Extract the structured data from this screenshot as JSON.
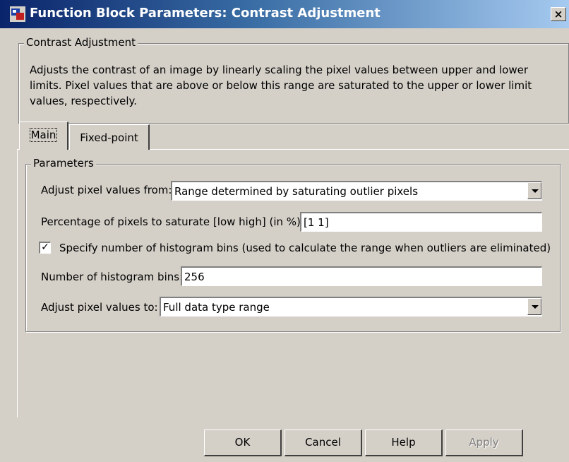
{
  "window": {
    "title": "Function Block Parameters: Contrast Adjustment",
    "close_label": "×"
  },
  "block": {
    "group_label": "Contrast Adjustment",
    "description": "Adjusts the contrast of an image by linearly scaling the pixel values between upper and lower limits. Pixel values that are above or below this range are saturated to the upper or lower limit values, respectively."
  },
  "tabs": [
    {
      "label": "Main",
      "selected": true
    },
    {
      "label": "Fixed-point",
      "selected": false
    }
  ],
  "parameters": {
    "group_label": "Parameters",
    "adjust_from": {
      "label": "Adjust pixel values from:",
      "value": "Range determined by saturating outlier pixels"
    },
    "percentage": {
      "label": "Percentage of pixels to saturate [low high] (in %):",
      "value": "[1 1]"
    },
    "specify_bins": {
      "label": "Specify number of histogram bins (used to calculate the range when outliers are eliminated)",
      "checked": true,
      "mark": "✓"
    },
    "num_bins": {
      "label": "Number of histogram bins:",
      "value": "256"
    },
    "adjust_to": {
      "label": "Adjust pixel values to:",
      "value": "Full data type range"
    }
  },
  "buttons": {
    "ok": "OK",
    "cancel": "Cancel",
    "help": "Help",
    "apply": "Apply"
  },
  "colors": {
    "titlebar_start": "#0a246a",
    "titlebar_end": "#a6caf0",
    "face": "#d4d0c8"
  }
}
